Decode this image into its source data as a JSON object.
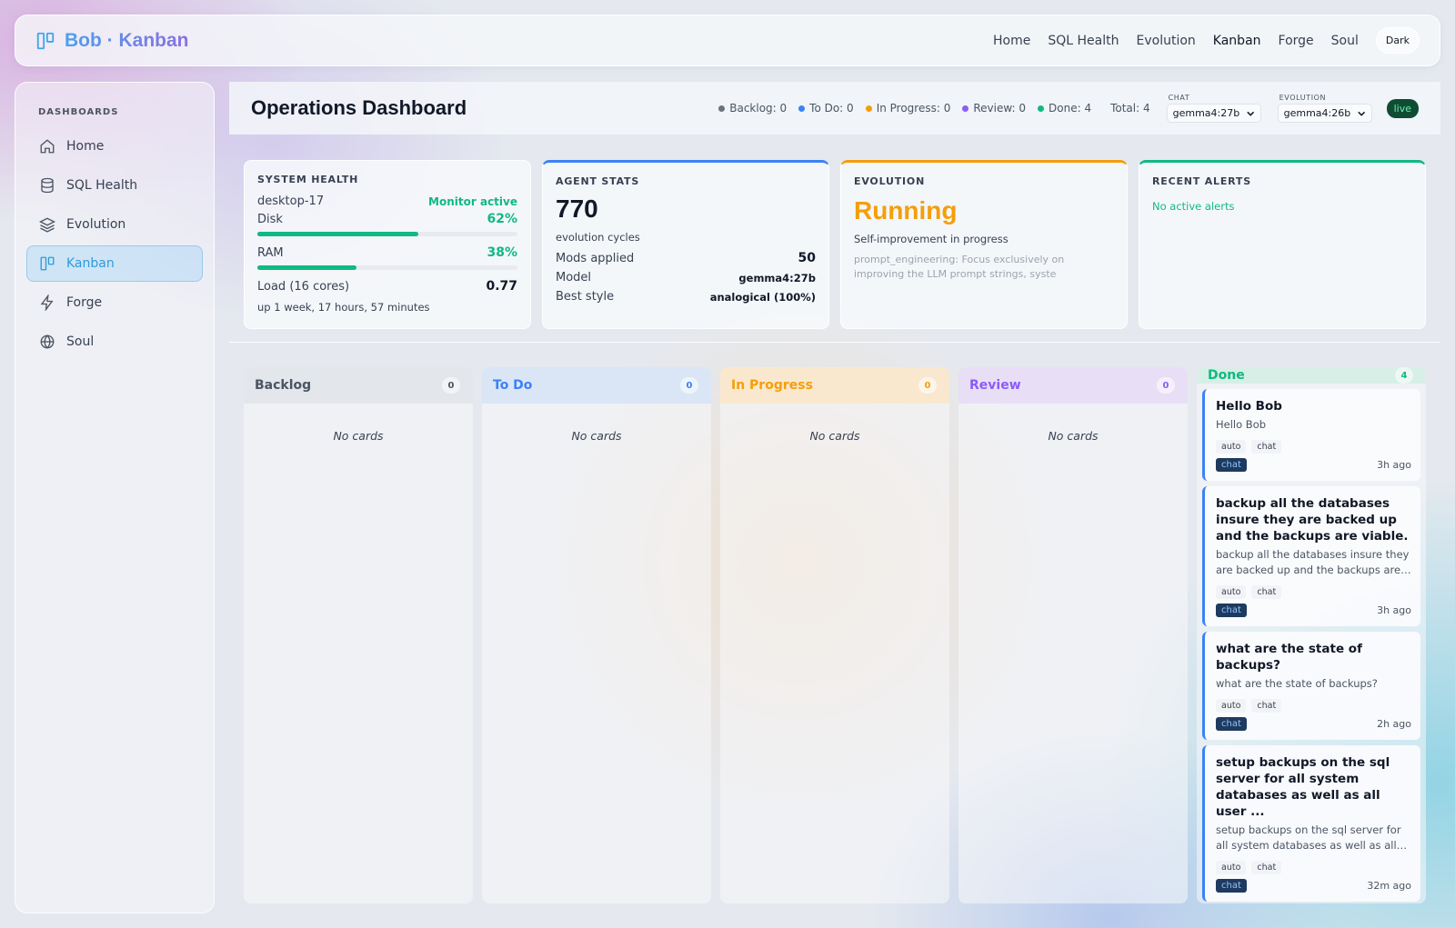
{
  "app": {
    "brand": "Bob · Kanban",
    "nav": [
      "Home",
      "SQL Health",
      "Evolution",
      "Kanban",
      "Forge",
      "Soul"
    ],
    "active_nav": "Kanban",
    "theme_button": "Dark"
  },
  "sidebar": {
    "title": "DASHBOARDS",
    "items": [
      {
        "label": "Home",
        "icon": "home-icon"
      },
      {
        "label": "SQL Health",
        "icon": "database-icon"
      },
      {
        "label": "Evolution",
        "icon": "layers-icon"
      },
      {
        "label": "Kanban",
        "icon": "kanban-icon"
      },
      {
        "label": "Forge",
        "icon": "lightning-icon"
      },
      {
        "label": "Soul",
        "icon": "globe-icon"
      }
    ]
  },
  "header": {
    "title": "Operations Dashboard",
    "counts": [
      {
        "label": "Backlog: 0",
        "color": "#6b7280"
      },
      {
        "label": "To Do: 0",
        "color": "#3b82f6"
      },
      {
        "label": "In Progress: 0",
        "color": "#f59e0b"
      },
      {
        "label": "Review: 0",
        "color": "#8b5cf6"
      },
      {
        "label": "Done: 4",
        "color": "#10b981"
      }
    ],
    "total": "Total: 4",
    "chat_label": "CHAT",
    "chat_model": "gemma4:27b",
    "evolution_label": "EVOLUTION",
    "evolution_model": "gemma4:26b",
    "live": "live"
  },
  "system_health": {
    "title": "SYSTEM HEALTH",
    "host": "desktop-17",
    "monitor": "Monitor active",
    "disk_label": "Disk",
    "disk_pct": "62%",
    "disk_fraction": 0.62,
    "ram_label": "RAM",
    "ram_pct": "38%",
    "ram_fraction": 0.38,
    "load_label": "Load (16 cores)",
    "load_value": "0.77",
    "uptime": "up 1 week, 17 hours, 57 minutes"
  },
  "agent_stats": {
    "title": "AGENT STATS",
    "cycles": "770",
    "cycles_label": "evolution cycles",
    "mods_label": "Mods applied",
    "mods_value": "50",
    "model_label": "Model",
    "model_value": "gemma4:27b",
    "style_label": "Best style",
    "style_value": "analogical (100%)"
  },
  "evolution": {
    "title": "EVOLUTION",
    "status": "Running",
    "subtitle": "Self-improvement in progress",
    "detail": "prompt_engineering: Focus exclusively on improving the LLM prompt strings, syste"
  },
  "alerts": {
    "title": "RECENT ALERTS",
    "message": "No active alerts"
  },
  "kanban": {
    "empty_text": "No cards",
    "columns": [
      {
        "name": "Backlog",
        "count": "0",
        "color": "#4b5563",
        "head_bg": "rgba(225,228,233,0.85)",
        "badge_color": "#4b5563"
      },
      {
        "name": "To Do",
        "count": "0",
        "color": "#3b82f6",
        "head_bg": "rgba(214,228,246,0.85)",
        "badge_color": "#3b82f6"
      },
      {
        "name": "In Progress",
        "count": "0",
        "color": "#f59e0b",
        "head_bg": "rgba(250,230,200,0.85)",
        "badge_color": "#f59e0b"
      },
      {
        "name": "Review",
        "count": "0",
        "color": "#8b5cf6",
        "head_bg": "rgba(230,220,246,0.85)",
        "badge_color": "#8b5cf6"
      },
      {
        "name": "Done",
        "count": "4",
        "color": "#10b981",
        "head_bg": "rgba(210,238,228,0.85)",
        "badge_color": "#10b981"
      }
    ],
    "done_cards": [
      {
        "title": "Hello Bob",
        "desc": "Hello Bob",
        "tags": [
          "auto",
          "chat"
        ],
        "chip": "chat",
        "ago": "3h ago"
      },
      {
        "title": "backup all the databases insure they are backed up and the backups are viable.",
        "desc": "backup all the databases insure they are backed up and the backups are viable.",
        "tags": [
          "auto",
          "chat"
        ],
        "chip": "chat",
        "ago": "3h ago"
      },
      {
        "title": "what are the state of backups?",
        "desc": "what are the state of backups?",
        "tags": [
          "auto",
          "chat"
        ],
        "chip": "chat",
        "ago": "2h ago"
      },
      {
        "title": "setup backups on the sql server for all system databases as well as all user ...",
        "desc": "setup backups on the sql server for all system databases as well as all user databases",
        "tags": [
          "auto",
          "chat"
        ],
        "chip": "chat",
        "ago": "32m ago"
      }
    ]
  }
}
